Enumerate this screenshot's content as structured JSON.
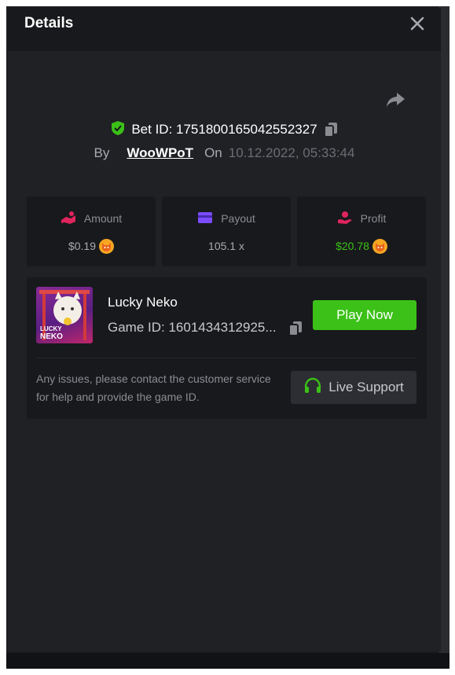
{
  "modal": {
    "title": "Details"
  },
  "bet": {
    "id_text": "Bet ID: 1751800165042552327",
    "by_label": "By",
    "username": "WooWPoT",
    "on_label": "On",
    "date": "10.12.2022, 05:33:44"
  },
  "stats": [
    {
      "label": "Amount",
      "value": "$0.19",
      "icon": "amount-icon",
      "color": "#e0245e"
    },
    {
      "label": "Payout",
      "value": "105.1 x",
      "icon": "payout-card-icon",
      "color": "#7b4cff"
    },
    {
      "label": "Profit",
      "value": "$20.78",
      "icon": "profit-icon",
      "color": "#e0245e"
    }
  ],
  "game": {
    "name": "Lucky Neko",
    "id_text": "Game ID: 1601434312925...",
    "thumb_text_1": "LUCKY",
    "thumb_text_2": "NEKO",
    "play_label": "Play Now"
  },
  "support": {
    "help_text": "Any issues, please contact the customer service for help and provide the game ID.",
    "button_label": "Live Support"
  },
  "colors": {
    "accent_green": "#3bc117",
    "modal_bg": "#202125",
    "panel_bg": "#18191c",
    "coin": "#f6a623"
  }
}
